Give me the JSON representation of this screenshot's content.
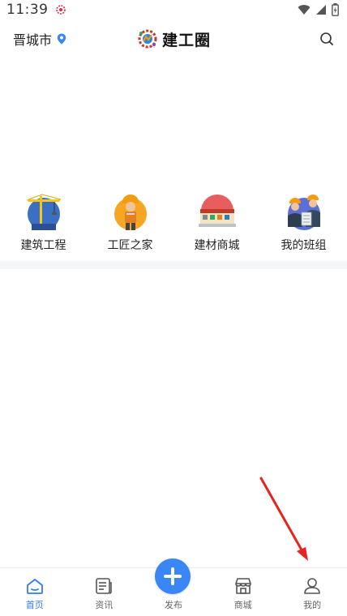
{
  "status_bar": {
    "time": "11:39"
  },
  "header": {
    "city": "晋城市",
    "app_title": "建工圈"
  },
  "categories": [
    {
      "label": "建筑工程",
      "icon": "tower-crane-icon"
    },
    {
      "label": "工匠之家",
      "icon": "construction-worker-icon"
    },
    {
      "label": "建材商城",
      "icon": "building-materials-store-icon"
    },
    {
      "label": "我的班组",
      "icon": "team-workers-icon"
    }
  ],
  "tabbar": {
    "items": [
      {
        "label": "首页",
        "icon": "home-icon",
        "active": true
      },
      {
        "label": "资讯",
        "icon": "news-icon",
        "active": false
      },
      {
        "label": "发布",
        "icon": "plus-icon",
        "active": false
      },
      {
        "label": "商城",
        "icon": "store-icon",
        "active": false
      },
      {
        "label": "我的",
        "icon": "user-icon",
        "active": false
      }
    ]
  },
  "colors": {
    "accent": "#2f7cf6",
    "arrow": "#e8221d"
  }
}
